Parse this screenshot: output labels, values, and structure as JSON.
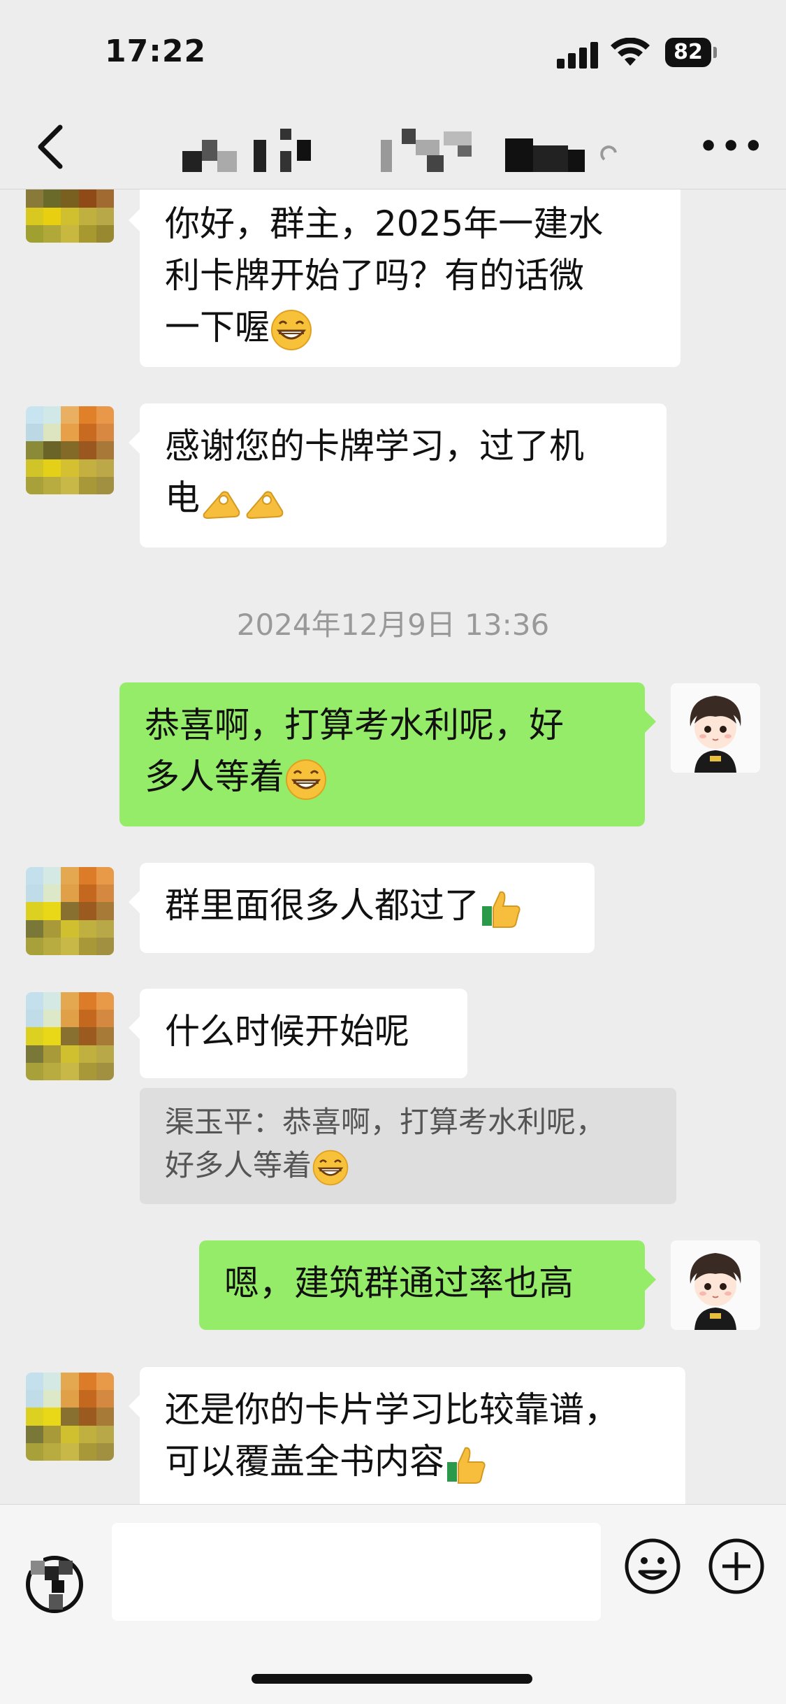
{
  "status_bar": {
    "time": "17:22",
    "battery": "82"
  },
  "header": {
    "title": "",
    "more_label": "•••"
  },
  "messages": [
    {
      "side": "left",
      "text": "你好，群主，2025年一建水利卡牌开始了吗？有的话微一下喔",
      "emoji": "grin"
    },
    {
      "side": "left",
      "text": "感谢您的卡牌学习，过了机电",
      "emoji": "ok-hand x2"
    },
    {
      "timestamp": "2024年12月9日 13:36"
    },
    {
      "side": "right",
      "text": "恭喜啊，打算考水利呢，好多人等着",
      "emoji": "grin"
    },
    {
      "side": "left",
      "text": "群里面很多人都过了",
      "emoji": "thumbs-up"
    },
    {
      "side": "left",
      "text": "什么时候开始呢",
      "quote": "渠玉平：恭喜啊，打算考水利呢，好多人等着"
    },
    {
      "side": "right",
      "text": "嗯，建筑群通过率也高"
    },
    {
      "side": "left",
      "text": "还是你的卡片学习比较靠谱，可以覆盖全书内容",
      "emoji": "thumbs-up"
    }
  ],
  "ui": {
    "m1_line1": "你好，群主，2025年一建水",
    "m1_line2": "利卡牌开始了吗？有的话微",
    "m1_line3": "一下喔",
    "m2_line1": "感谢您的卡牌学习，过了机",
    "m2_line2": "电",
    "timestamp": "2024年12月9日 13:36",
    "m3_line1": "恭喜啊，打算考水利呢，好",
    "m3_line2": "多人等着",
    "m4_line1": "群里面很多人都过了",
    "m5_line1": "什么时候开始呢",
    "quote_line1": "渠玉平：恭喜啊，打算考水利呢，",
    "quote_line2": "好多人等着",
    "m6_line1": "嗯，建筑群通过率也高",
    "m7_line1": "还是你的卡片学习比较靠谱，",
    "m7_line2": "可以覆盖全书内容"
  },
  "input": {
    "placeholder": ""
  },
  "colors": {
    "background": "#ededed",
    "self_bubble": "#95ec69",
    "other_bubble": "#ffffff",
    "quote_bg": "#dedede"
  }
}
